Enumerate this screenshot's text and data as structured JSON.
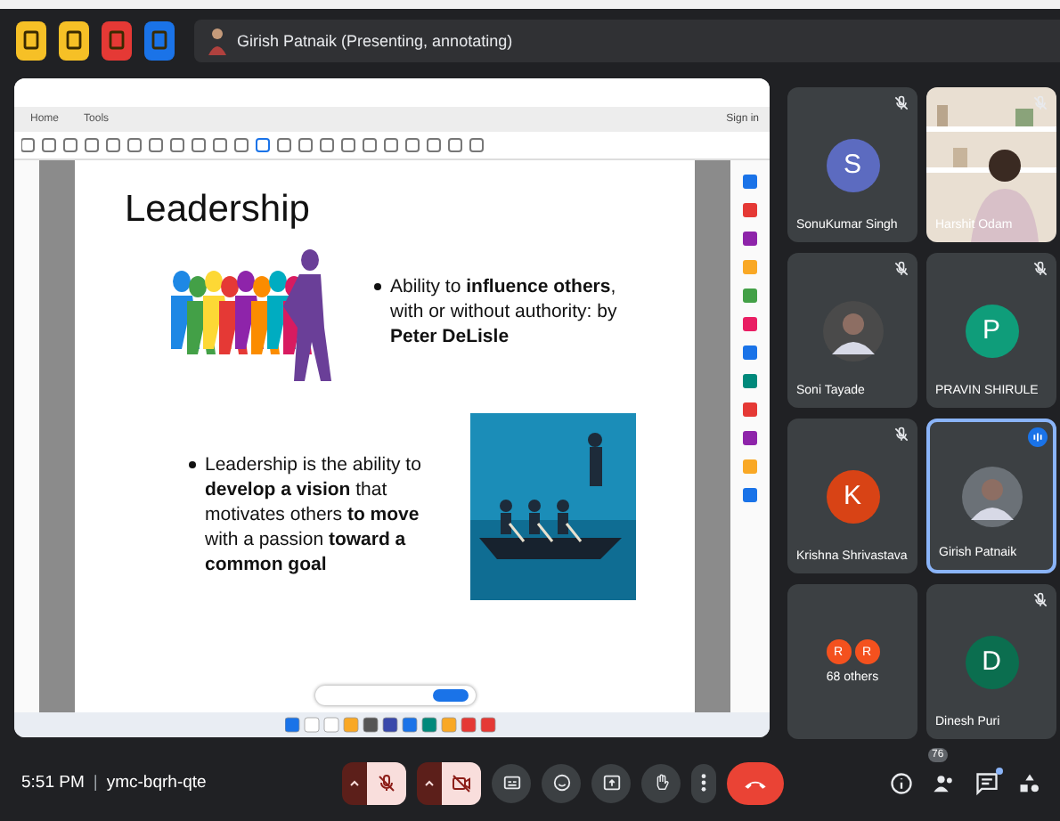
{
  "top_bar": {
    "presenter_chip": {
      "label": "Girish Patnaik (Presenting, annotating)"
    }
  },
  "shared_screen": {
    "reader": {
      "tabs": [
        {
          "label": "Home",
          "selected": false
        },
        {
          "label": "Tools",
          "selected": false
        }
      ],
      "sign_in": "Sign in"
    },
    "slide": {
      "title": "Leadership",
      "bullets": [
        {
          "text": "Ability to **influence others**, with or without authority: by **Peter DeLisle**"
        },
        {
          "text": "Leadership is the ability to **develop a vision** that motivates others **to move** with a passion **toward a common goal**"
        }
      ]
    }
  },
  "participants": [
    {
      "kind": "initial",
      "name": "SonuKumar Singh",
      "initial": "S",
      "color": "#5c6bc0",
      "muted": true,
      "speaking": false
    },
    {
      "kind": "video",
      "name": "Harshit Odam",
      "muted": true,
      "speaking": false
    },
    {
      "name": "Soni Tayade",
      "muted": true,
      "speaking": false
    },
    {
      "kind": "initial",
      "name": "PRAVIN SHIRULE",
      "initial": "P",
      "color": "#0f9d7a",
      "muted": true,
      "speaking": false
    },
    {
      "kind": "initial",
      "name": "Krishna Shrivastava",
      "initial": "K",
      "color": "#d84315",
      "muted": true,
      "speaking": false
    },
    {
      "name": "Girish Patnaik",
      "muted": false,
      "speaking": true
    },
    {
      "kind": "others",
      "name": "68 others",
      "avatars": [
        {
          "initial": "R",
          "color": "#f4511e"
        },
        {
          "initial": "R",
          "color": "#f4511e"
        }
      ],
      "muted": false,
      "speaking": false
    },
    {
      "kind": "initial",
      "name": "Dinesh Puri",
      "initial": "D",
      "color": "#0b6e4f",
      "muted": true,
      "speaking": false
    }
  ],
  "bottom_bar": {
    "time": "5:51 PM",
    "separator": "|",
    "meeting_code": "ymc-bqrh-qte",
    "mic": {
      "on": false
    },
    "camera": {
      "on": false
    },
    "people_count": "76",
    "chat_unread": true
  }
}
